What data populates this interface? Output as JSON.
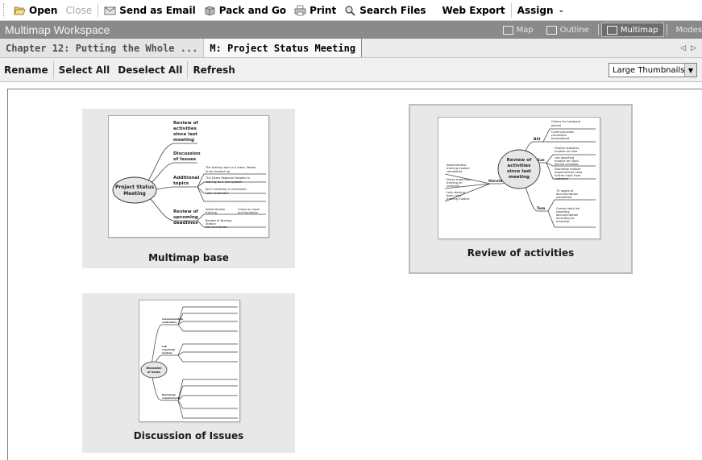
{
  "toolbar": {
    "open": "Open",
    "close": "Close",
    "send_email": "Send as Email",
    "pack_go": "Pack and Go",
    "print": "Print",
    "search_files": "Search Files",
    "web_export": "Web Export",
    "assign": "Assign"
  },
  "workspace": {
    "title": "Multimap Workspace",
    "views": [
      "Map",
      "Outline",
      "Multimap",
      "Modes"
    ]
  },
  "tabs": [
    {
      "label": "Chapter 12: Putting the Whole ..."
    },
    {
      "label": "M: Project Status Meeting"
    }
  ],
  "commands": {
    "rename": "Rename",
    "select_all": "Select All",
    "deselect_all": "Deselect All",
    "refresh": "Refresh"
  },
  "view_select": {
    "value": "Large Thumbnails"
  },
  "thumbnails": [
    {
      "caption": "Multimap base",
      "center": [
        "Project Status",
        "Meeting"
      ],
      "branches": [
        "Review of",
        "activities",
        "since last",
        "meeting",
        "Discussion",
        "of Issues",
        "Additional",
        "topics",
        "Review of",
        "upcoming",
        "deadlines"
      ],
      "notes": [
        "The testing room is a mess. Needs",
        "to be cleaned up",
        "The Dyers Regional Hospital is",
        "looking for a new system",
        "Jenn's birthday is next week.",
        "Let's celebrate?",
        "Administrator",
        "training",
        "Check on room",
        "and handouts",
        "Review of Nursing",
        "Station",
        "documentation"
      ]
    },
    {
      "caption": "Review of activities",
      "center": [
        "Review of",
        "activities",
        "since last",
        "meeting"
      ],
      "branches": [
        "Bill",
        "Sue",
        "Harold",
        "Tom"
      ],
      "notes": [
        "Orders for hardware",
        "placed",
        "Communication",
        "controllers",
        "backordered",
        "Finalize statistics",
        "module on time",
        "Lab reporting",
        "module ten days",
        "behind schedule",
        "Discharge module",
        "requirements need",
        "further input from",
        "customer",
        "Administrator",
        "training module",
        "completed",
        "Nurse supervisor",
        "training on",
        "schedule",
        "Late starting",
        "basic user",
        "training module",
        "74 pages of",
        "documentation",
        "completed.",
        "Cannot start lab",
        "reporting",
        "documentation",
        "according to",
        "schedule."
      ]
    },
    {
      "caption": "Discussion of Issues",
      "center": [
        "Discussion",
        "of Issues"
      ],
      "branches": [
        "Communication",
        "controllers",
        "Lab",
        "reporting",
        "module",
        "Discharge",
        "requirements"
      ]
    }
  ]
}
